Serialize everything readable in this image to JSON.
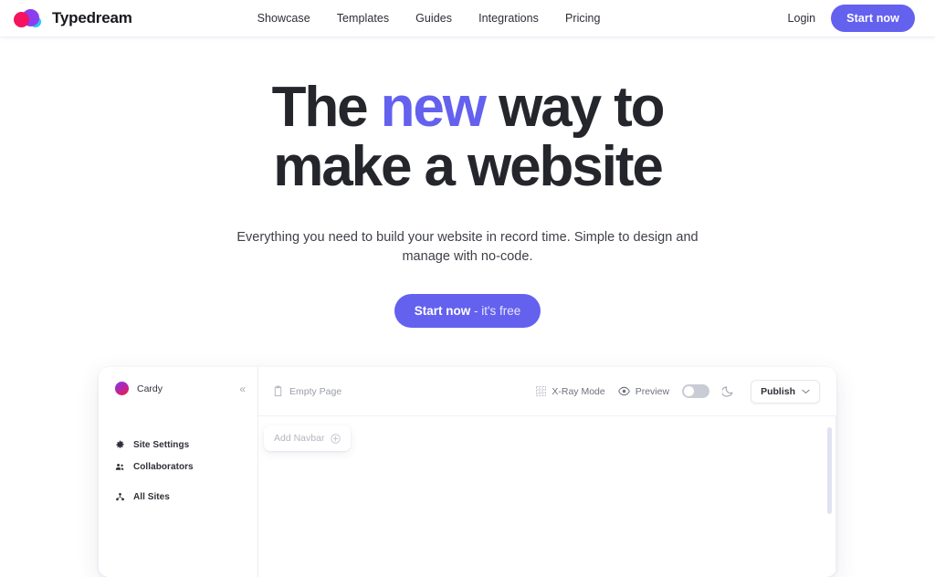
{
  "header": {
    "brand": {
      "name": "Typedream",
      "logo_icon": "typedream-cloud-logo"
    },
    "nav": [
      {
        "label": "Showcase"
      },
      {
        "label": "Templates"
      },
      {
        "label": "Guides"
      },
      {
        "label": "Integrations"
      },
      {
        "label": "Pricing"
      }
    ],
    "login_label": "Login",
    "start_now_label": "Start now"
  },
  "hero": {
    "headline_part1": "The ",
    "headline_accent": "new",
    "headline_part2": " way to",
    "headline_line2": "make a website",
    "subtitle": "Everything you need to build your website in record time. Simple to design and manage with no-code.",
    "cta_bold": "Start now",
    "cta_light": " - it's free"
  },
  "app_mockup": {
    "sidebar": {
      "site_name": "Cardy",
      "avatar_icon": "site-avatar",
      "collapse_icon": "chevron-double-left-icon",
      "items": [
        {
          "label": "Site Settings",
          "icon": "gear-icon"
        },
        {
          "label": "Collaborators",
          "icon": "users-icon"
        },
        {
          "label": "All Sites",
          "icon": "sites-grid-icon"
        }
      ]
    },
    "toolbar": {
      "page_label": "Empty Page",
      "page_icon": "document-icon",
      "xray_label": "X-Ray Mode",
      "xray_icon": "grid-dashed-icon",
      "preview_label": "Preview",
      "preview_icon": "eye-icon",
      "dark_mode_icon": "moon-icon",
      "theme_toggle_state": "off",
      "publish_label": "Publish",
      "publish_chevron_icon": "chevron-down-icon"
    },
    "canvas": {
      "add_navbar_label": "Add Navbar",
      "add_navbar_icon": "plus-circle-icon"
    },
    "scrollbar_name": "vertical-scrollbar"
  },
  "colors": {
    "accent": "#6461ef",
    "heading": "#25262c",
    "body_text": "#3d4047",
    "muted": "#9b9ea9"
  }
}
